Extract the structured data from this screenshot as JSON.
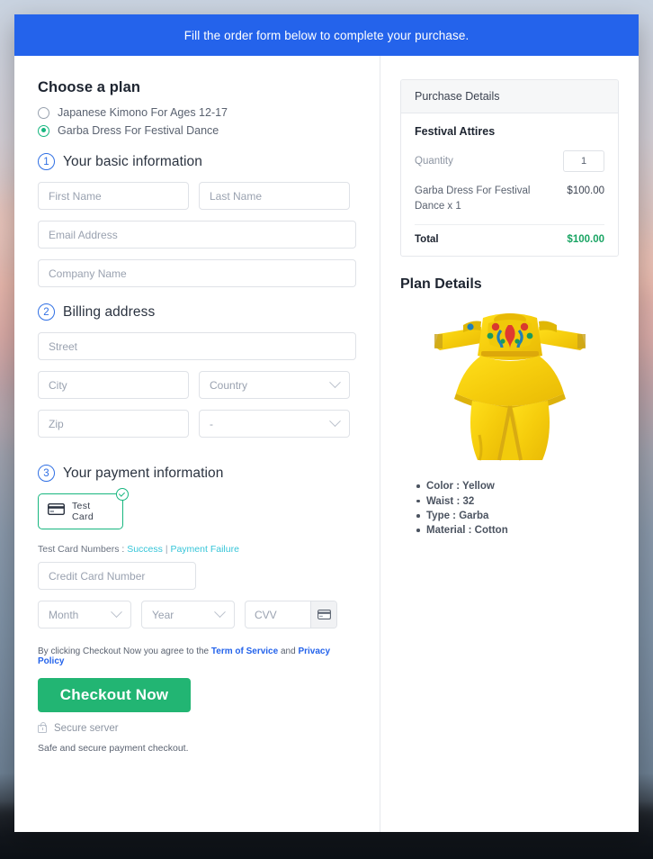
{
  "banner": {
    "text": "Fill the order form below to complete your purchase."
  },
  "plan": {
    "title": "Choose a plan",
    "options": [
      {
        "label": "Japanese Kimono For Ages 12-17",
        "selected": false
      },
      {
        "label": "Garba Dress For Festival Dance",
        "selected": true
      }
    ]
  },
  "steps": {
    "basic": {
      "num": "1",
      "label": "Your basic information"
    },
    "billing": {
      "num": "2",
      "label": "Billing address"
    },
    "payment": {
      "num": "3",
      "label": "Your payment information"
    }
  },
  "basic_fields": {
    "first_name": "First Name",
    "last_name": "Last Name",
    "email": "Email Address",
    "company": "Company Name"
  },
  "billing_fields": {
    "street": "Street",
    "city": "City",
    "country": "Country",
    "zip": "Zip",
    "state": "-"
  },
  "payment": {
    "test_card_label": "Test Card",
    "card_icon": "credit-card-icon",
    "check_icon": "check-circle-icon",
    "test_numbers_prefix": "Test Card Numbers :",
    "link_success": "Success",
    "link_divider": "|",
    "link_failure": "Payment Failure",
    "card_number": "Credit Card Number",
    "month": "Month",
    "year": "Year",
    "cvv": "CVV",
    "cvv_icon": "credit-card-icon"
  },
  "footer": {
    "terms_pre": "By clicking Checkout Now you agree to the",
    "terms_link": "Term of Service",
    "terms_and": "and",
    "privacy_link": "Privacy Policy",
    "checkout_label": "Checkout Now",
    "secure_label": "Secure server",
    "lock_icon": "lock-icon",
    "safe_note": "Safe and secure payment checkout."
  },
  "purchase": {
    "header": "Purchase Details",
    "product": "Festival Attires",
    "quantity_label": "Quantity",
    "quantity_value": "1",
    "line_desc": "Garba Dress For Festival Dance x 1",
    "line_amount": "$100.00",
    "total_label": "Total",
    "total_amount": "$100.00"
  },
  "plan_details": {
    "title": "Plan Details",
    "image_alt": "garba-dress-image",
    "specs": [
      "Color : Yellow",
      "Waist : 32",
      "Type : Garba",
      "Material  : Cotton"
    ]
  },
  "colors": {
    "banner_blue": "#2463eb",
    "accent_green": "#22b573",
    "radio_green": "#17b67f",
    "link_cyan": "#36c5d8",
    "total_green": "#19a463",
    "step_blue": "#2f6fe4",
    "dress_yellow": "#f5d311"
  }
}
